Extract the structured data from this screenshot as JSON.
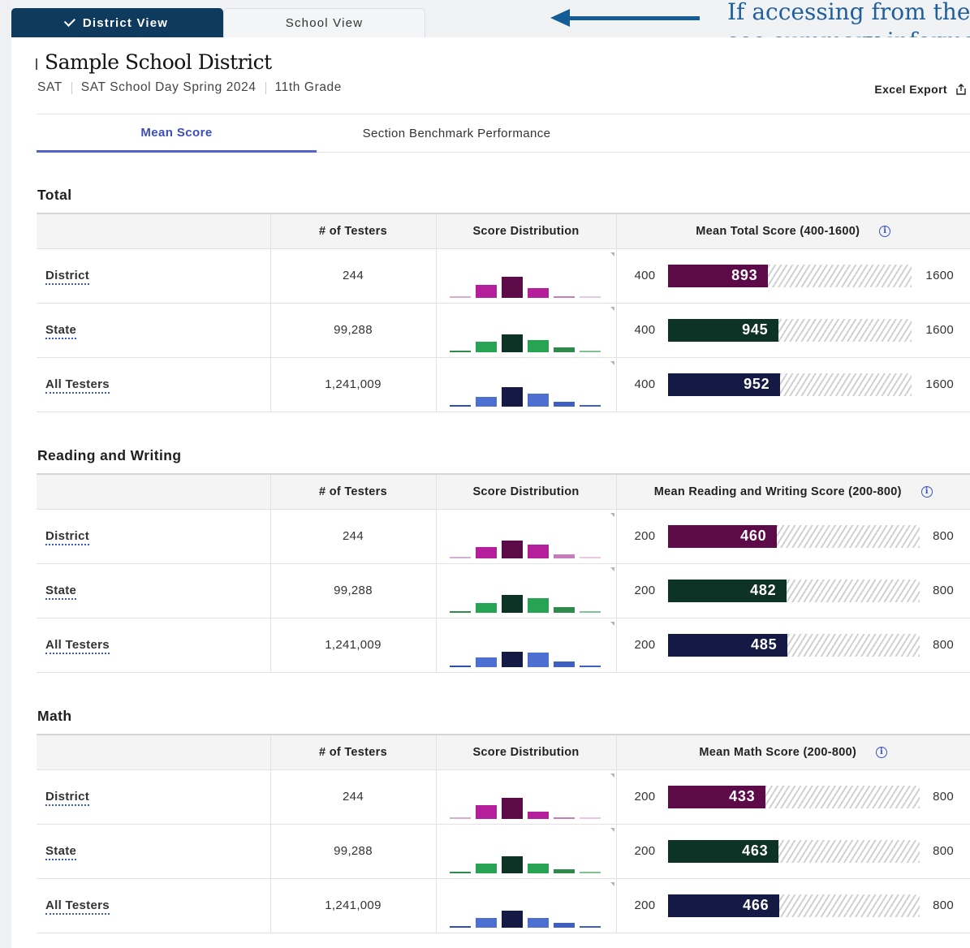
{
  "view_tabs": {
    "district_view": "District View",
    "school_view": "School View"
  },
  "callout": {
    "line1": "If accessing from the",
    "line2": "see summary information"
  },
  "header": {
    "title": "Sample School District",
    "assessment": "SAT",
    "administration": "SAT School Day Spring 2024",
    "grade": "11th Grade",
    "excel_export": "Excel Export"
  },
  "score_tabs": {
    "mean_score": "Mean Score",
    "benchmark": "Section Benchmark Performance"
  },
  "colors": {
    "district": [
      "#d6aed0",
      "#b51f9b",
      "#5c0a48",
      "#b51f9b",
      "#c77dbb",
      "#e6c8e1"
    ],
    "state": [
      "#2e8b4c",
      "#27a354",
      "#0d3327",
      "#27a354",
      "#2e8b4c",
      "#7ec495"
    ],
    "all": [
      "#2e4fb0",
      "#4c6fd1",
      "#151a45",
      "#4c6fd1",
      "#3f5fc3",
      "#3f5fc3"
    ],
    "district_fill": "#5c0a48",
    "state_fill": "#0d3327",
    "all_fill": "#151a45"
  },
  "sections": [
    {
      "title": "Total",
      "headers": [
        "",
        "# of Testers",
        "Score Distribution",
        "Mean Total Score (400-1600)"
      ],
      "min": 400,
      "max": 1600,
      "min_label": "400",
      "max_label": "1600",
      "rows": [
        {
          "label": "District",
          "testers": "244",
          "mean": 893,
          "mean_label": "893",
          "dist": [
            0.05,
            0.4,
            0.65,
            0.3,
            0.05,
            0.03
          ],
          "group": "district"
        },
        {
          "label": "State",
          "testers": "99,288",
          "mean": 945,
          "mean_label": "945",
          "dist": [
            0.06,
            0.33,
            0.55,
            0.38,
            0.16,
            0.04
          ],
          "group": "state"
        },
        {
          "label": "All Testers",
          "testers": "1,241,009",
          "mean": 952,
          "mean_label": "952",
          "dist": [
            0.05,
            0.3,
            0.6,
            0.4,
            0.15,
            0.04
          ],
          "group": "all"
        }
      ]
    },
    {
      "title": "Reading and Writing",
      "headers": [
        "",
        "# of Testers",
        "Score Distribution",
        "Mean Reading and Writing Score (200-800)"
      ],
      "min": 200,
      "max": 800,
      "min_label": "200",
      "max_label": "800",
      "rows": [
        {
          "label": "District",
          "testers": "244",
          "mean": 460,
          "mean_label": "460",
          "dist": [
            0.06,
            0.35,
            0.55,
            0.42,
            0.12,
            0.05
          ],
          "group": "district"
        },
        {
          "label": "State",
          "testers": "99,288",
          "mean": 482,
          "mean_label": "482",
          "dist": [
            0.05,
            0.3,
            0.55,
            0.45,
            0.18,
            0.05
          ],
          "group": "state"
        },
        {
          "label": "All Testers",
          "testers": "1,241,009",
          "mean": 485,
          "mean_label": "485",
          "dist": [
            0.05,
            0.3,
            0.48,
            0.45,
            0.18,
            0.05
          ],
          "group": "all"
        }
      ]
    },
    {
      "title": "Math",
      "headers": [
        "",
        "# of Testers",
        "Score Distribution",
        "Mean Math Score (200-800)"
      ],
      "min": 200,
      "max": 800,
      "min_label": "200",
      "max_label": "800",
      "rows": [
        {
          "label": "District",
          "testers": "244",
          "mean": 433,
          "mean_label": "433",
          "dist": [
            0.05,
            0.42,
            0.65,
            0.22,
            0.05,
            0.03
          ],
          "group": "district"
        },
        {
          "label": "State",
          "testers": "99,288",
          "mean": 463,
          "mean_label": "463",
          "dist": [
            0.05,
            0.3,
            0.53,
            0.3,
            0.12,
            0.04
          ],
          "group": "state"
        },
        {
          "label": "All Testers",
          "testers": "1,241,009",
          "mean": 466,
          "mean_label": "466",
          "dist": [
            0.05,
            0.3,
            0.52,
            0.3,
            0.15,
            0.04
          ],
          "group": "all"
        }
      ]
    }
  ]
}
